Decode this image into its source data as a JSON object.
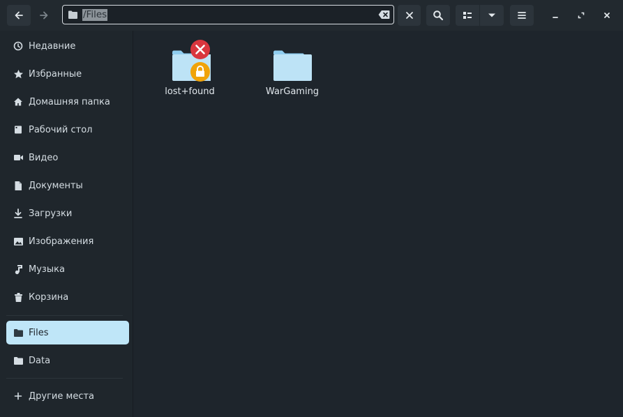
{
  "header": {
    "location_text": "/Files",
    "icons": {
      "back": "arrow-left-icon",
      "forward": "arrow-right-icon",
      "folder": "folder-icon",
      "clear": "backspace-icon",
      "close_location": "close-icon",
      "search": "search-icon",
      "view": "list-view-icon",
      "view_menu": "chevron-down-icon",
      "menu": "hamburger-icon",
      "minimize": "minimize-icon",
      "maximize": "maximize-icon",
      "close": "close-icon"
    }
  },
  "sidebar": {
    "items": [
      {
        "label": "Недавние",
        "icon": "clock-icon"
      },
      {
        "label": "Избранные",
        "icon": "star-icon"
      },
      {
        "label": "Домашняя папка",
        "icon": "home-icon"
      },
      {
        "label": "Рабочий стол",
        "icon": "desktop-icon"
      },
      {
        "label": "Видео",
        "icon": "video-icon"
      },
      {
        "label": "Документы",
        "icon": "document-icon"
      },
      {
        "label": "Загрузки",
        "icon": "download-icon"
      },
      {
        "label": "Изображения",
        "icon": "image-icon"
      },
      {
        "label": "Музыка",
        "icon": "music-icon"
      },
      {
        "label": "Корзина",
        "icon": "trash-icon"
      }
    ],
    "mounts": [
      {
        "label": "Files",
        "icon": "folder-icon",
        "active": true
      },
      {
        "label": "Data",
        "icon": "folder-icon",
        "active": false
      }
    ],
    "other_places": {
      "label": "Другие места",
      "icon": "plus-icon"
    }
  },
  "files": [
    {
      "name": "lost+found",
      "icon": "folder-icon",
      "emblems": [
        "unreadable-icon",
        "lock-icon"
      ]
    },
    {
      "name": "WarGaming",
      "icon": "folder-icon",
      "emblems": []
    }
  ],
  "colors": {
    "accent": "#bfe6f8",
    "folder": "#bde3f6",
    "folder_tab": "#8fcdef",
    "error_emblem": "#d9363e",
    "lock_emblem": "#f0a30a"
  }
}
